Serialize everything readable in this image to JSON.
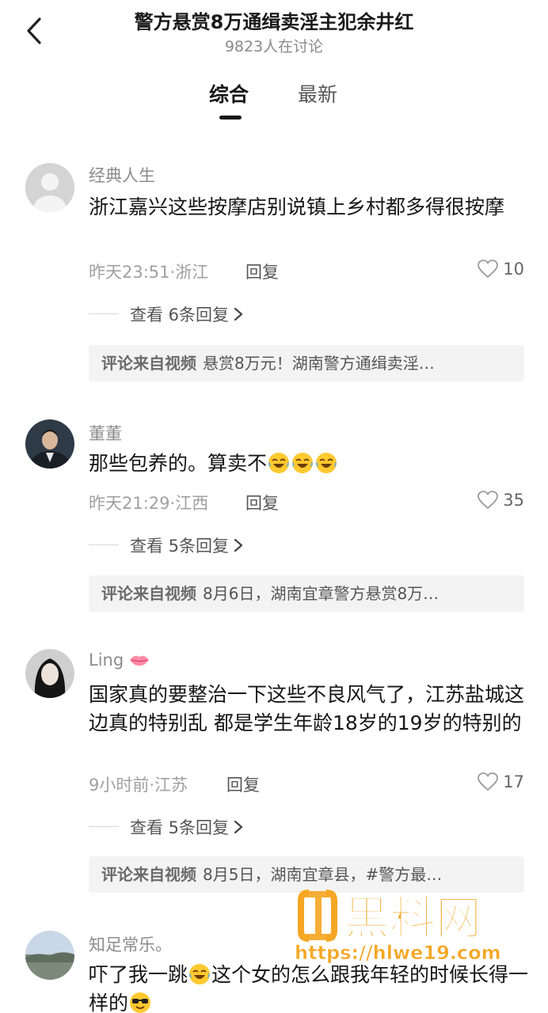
{
  "header": {
    "title": "警方悬赏8万通缉卖淫主犯余井红",
    "subtitle": "9823人在讨论"
  },
  "tabs": [
    {
      "label": "综合",
      "active": true
    },
    {
      "label": "最新",
      "active": false
    }
  ],
  "reply_label": "回复",
  "source_label": "评论来自视频",
  "comments": [
    {
      "username": "经典人生",
      "text": "浙江嘉兴这些按摩店别说镇上乡村都多得很按摩",
      "time_location": "昨天23:51·浙江",
      "likes": "10",
      "replies_link": "查看 6条回复",
      "source": "悬赏8万元！湖南警方通缉卖淫…"
    },
    {
      "username": "董董",
      "text": "那些包养的。算卖不",
      "emoji": "laugh-cry",
      "emoji_count": 3,
      "time_location": "昨天21:29·江西",
      "likes": "35",
      "replies_link": "查看 5条回复",
      "source": "8月6日，湖南宜章警方悬赏8万…"
    },
    {
      "username": "Ling",
      "username_emoji": "lips",
      "text": "国家真的要整治一下这些不良风气了，江苏盐城这边真的特别乱 都是学生年龄18岁的19岁的特别的",
      "time_location": "9小时前·江苏",
      "likes": "17",
      "replies_link": "查看 5条回复",
      "source": "8月5日，湖南宜章县，#警方最…"
    },
    {
      "username": "知足常乐。",
      "text_part1": "吓了我一跳",
      "text_part2": "这个女的怎么跟我年轻的时候长得一样的",
      "emoji1": "laugh-cry",
      "emoji2": "sunglasses"
    }
  ],
  "watermark": {
    "logo_text": "黑料网",
    "url": "https://hlwe19.com",
    "color": "#f5a623"
  }
}
